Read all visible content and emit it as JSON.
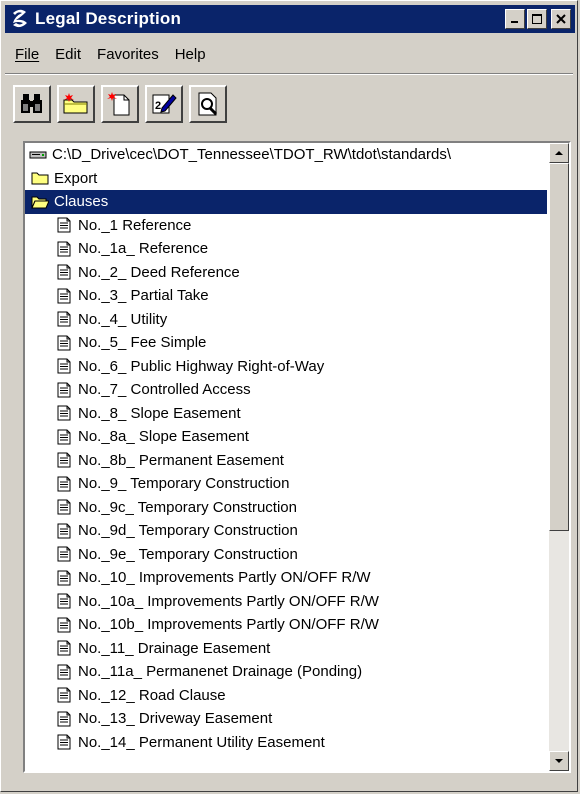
{
  "window": {
    "title": "Legal Description"
  },
  "controls": {
    "minimize": "_",
    "maximize": "□",
    "close": "×"
  },
  "menu": [
    {
      "label": "File"
    },
    {
      "label": "Edit"
    },
    {
      "label": "Favorites"
    },
    {
      "label": "Help"
    }
  ],
  "toolbar": [
    {
      "icon": "binoculars-icon"
    },
    {
      "icon": "new-folder-icon"
    },
    {
      "icon": "new-document-icon"
    },
    {
      "icon": "edit-icon"
    },
    {
      "icon": "preview-icon"
    }
  ],
  "tree": {
    "root_path": "C:\\D_Drive\\cec\\DOT_Tennessee\\TDOT_RW\\tdot\\standards\\",
    "folders": [
      {
        "label": "Export"
      },
      {
        "label": "Clauses",
        "selected": true
      }
    ],
    "clauses": [
      "No._1 Reference",
      "No._1a_ Reference",
      "No._2_ Deed Reference",
      "No._3_ Partial Take",
      "No._4_ Utility",
      "No._5_ Fee Simple",
      "No._6_ Public Highway Right-of-Way",
      "No._7_ Controlled Access",
      "No._8_ Slope Easement",
      "No._8a_ Slope Easement",
      "No._8b_ Permanent Easement",
      "No._9_ Temporary Construction",
      "No._9c_ Temporary Construction",
      "No._9d_ Temporary Construction",
      "No._9e_ Temporary Construction",
      "No._10_ Improvements Partly ON/OFF R/W",
      "No._10a_ Improvements Partly ON/OFF R/W",
      "No._10b_ Improvements Partly ON/OFF R/W",
      "No._11_ Drainage Easement",
      "No._11a_ Permanenet Drainage (Ponding)",
      "No._12_ Road Clause",
      "No._13_ Driveway Easement",
      "No._14_ Permanent Utility Easement"
    ]
  }
}
